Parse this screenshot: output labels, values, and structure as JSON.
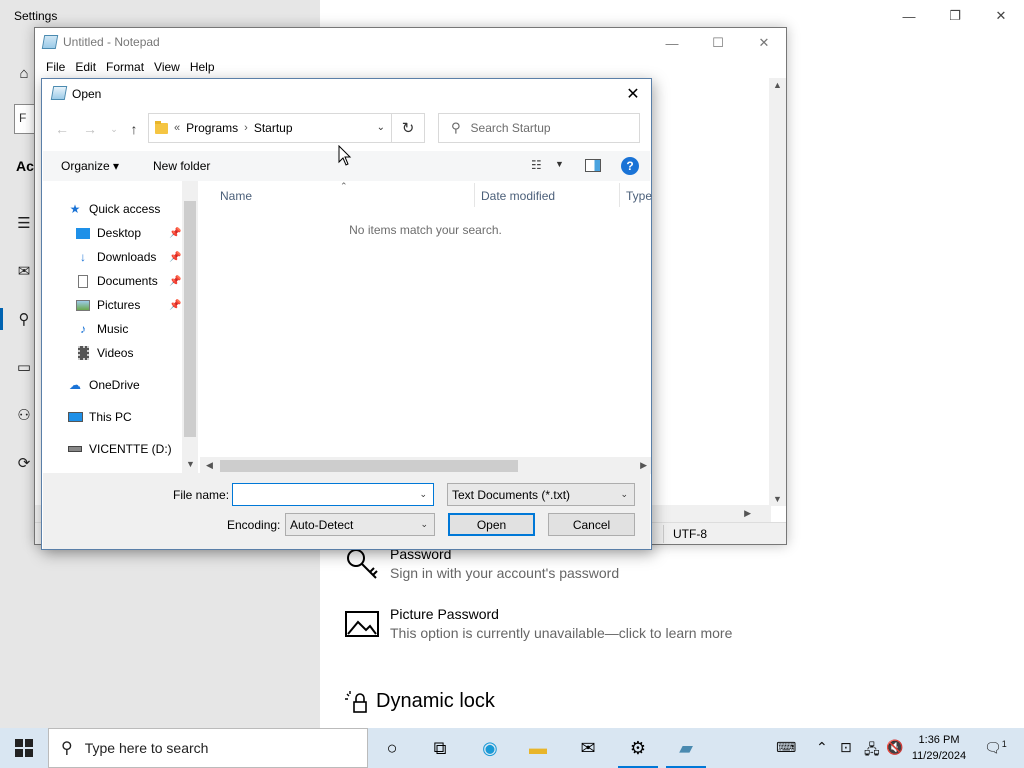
{
  "settings": {
    "title": "Settings",
    "side_heading": "Ac",
    "options": [
      {
        "title": "Password",
        "subtitle": "Sign in with your account's password"
      },
      {
        "title": "Picture Password",
        "subtitle": "This option is currently unavailable—click to learn more"
      }
    ],
    "dynamic_lock": "Dynamic lock"
  },
  "notepad": {
    "title": "Untitled - Notepad",
    "menu": [
      "File",
      "Edit",
      "Format",
      "View",
      "Help"
    ],
    "encoding": "UTF-8"
  },
  "dialog": {
    "title": "Open",
    "address": {
      "overflow": "«",
      "crumbs": [
        "Programs",
        "Startup"
      ]
    },
    "search_placeholder": "Search Startup",
    "organize": "Organize",
    "new_folder": "New folder",
    "nav": {
      "quick_access": "Quick access",
      "items": [
        "Desktop",
        "Downloads",
        "Documents",
        "Pictures",
        "Music",
        "Videos"
      ],
      "onedrive": "OneDrive",
      "this_pc": "This PC",
      "drive": "VICENTTE (D:)"
    },
    "columns": [
      "Name",
      "Date modified",
      "Type"
    ],
    "empty_message": "No items match your search.",
    "file_name_label": "File name:",
    "file_name_value": "",
    "file_type": "Text Documents (*.txt)",
    "encoding_label": "Encoding:",
    "encoding_value": "Auto-Detect",
    "open_button": "Open",
    "cancel_button": "Cancel"
  },
  "taskbar": {
    "search_placeholder": "Type here to search",
    "time": "1:36 PM",
    "date": "11/29/2024",
    "notification_count": "1"
  },
  "colors": {
    "accent": "#0078d7",
    "selection": "#cce8ff",
    "taskbar": "#d9e6f2"
  }
}
